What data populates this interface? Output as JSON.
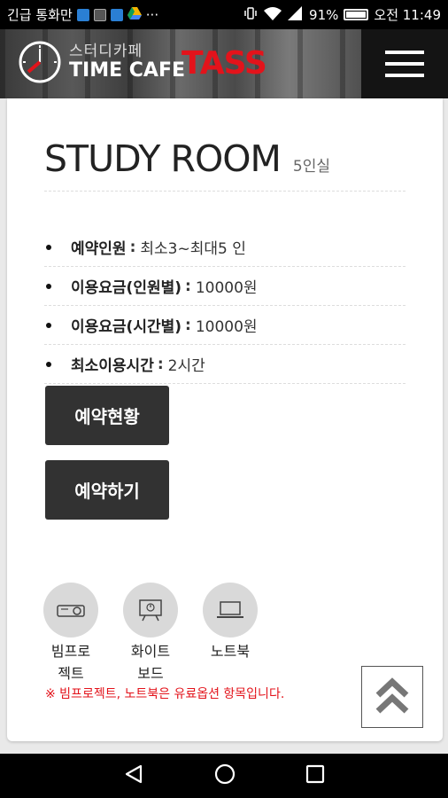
{
  "status_bar": {
    "left_text": "긴급 통화만",
    "more": "···",
    "battery": "91%",
    "time": "오전 11:49"
  },
  "header": {
    "brand_korean": "스터디카페",
    "brand_english": "TIME CAFE",
    "brand_name": "TASS",
    "brand_color": "#e3131b",
    "menu_icon": "hamburger-icon"
  },
  "room": {
    "title": "STUDY ROOM",
    "subtitle": "5인실"
  },
  "info": [
    {
      "label": "예약인원",
      "value": "최소3~최대5 인"
    },
    {
      "label": "이용요금(인원별)",
      "value": "10000원"
    },
    {
      "label": "이용요금(시간별)",
      "value": "10000원"
    },
    {
      "label": "최소이용시간",
      "value": "2시간"
    }
  ],
  "buttons": {
    "status": "예약현황",
    "reserve": "예약하기"
  },
  "equipment": [
    {
      "name_line1": "빔프로",
      "name_line2": "젝트",
      "icon": "projector-icon"
    },
    {
      "name_line1": "화이트",
      "name_line2": "보드",
      "icon": "whiteboard-icon"
    },
    {
      "name_line1": "노트북",
      "name_line2": "",
      "icon": "laptop-icon"
    }
  ],
  "note": "※ 빔프로젝트, 노트북은 유료옵션 항목입니다.",
  "scroll_top_icon": "double-chevron-up-icon",
  "nav": {
    "back_icon": "back-triangle-icon",
    "home_icon": "home-circle-icon",
    "recent_icon": "recent-square-icon"
  }
}
